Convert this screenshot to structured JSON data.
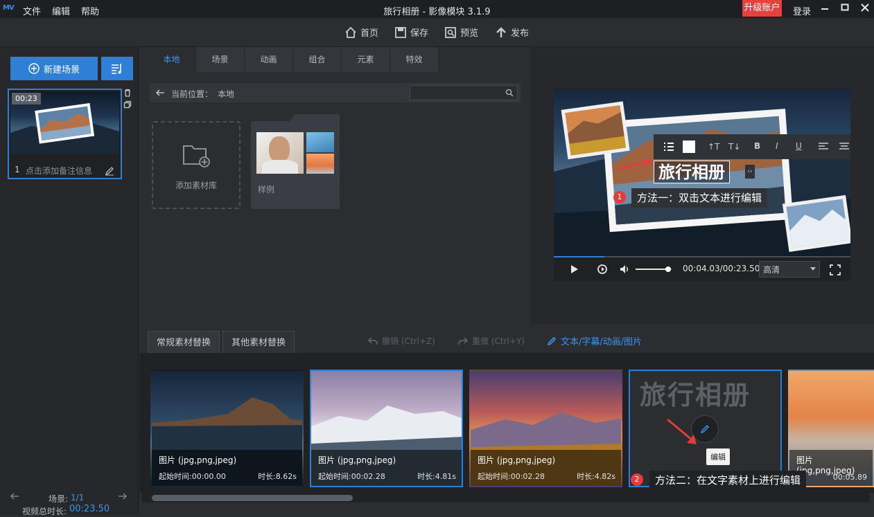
{
  "titlebar": {
    "logo": "MV",
    "menus": [
      "文件",
      "编辑",
      "帮助"
    ],
    "title": "旅行相册 - 影像模块 3.1.9",
    "upgrade": "升级账户",
    "login": "登录"
  },
  "toolbar": {
    "home": "首页",
    "save": "保存",
    "preview": "预览",
    "publish": "发布"
  },
  "left": {
    "new_scene": "新建场景",
    "scene_duration": "00:23",
    "scene_index": "1",
    "scene_note": "点击添加备注信息",
    "scene_label": "场景:",
    "scene_count": "1/1",
    "total_label": "视频总时长:",
    "total_time": "00:23.50"
  },
  "library": {
    "tabs": [
      "本地",
      "场景",
      "动画",
      "组合",
      "元素",
      "特效"
    ],
    "path_label": "当前位置：",
    "path_value": "本地",
    "add_library": "添加素材库",
    "sample": "样例"
  },
  "preview": {
    "title_text": "旅行相册",
    "hint1_num": "1",
    "hint1": "方法一：双击文本进行编辑",
    "time": "00:04.03/00:23.50",
    "quality": "高清",
    "progress": 0.17,
    "volume": 0.9
  },
  "bottom": {
    "tab1": "常规素材替换",
    "tab2": "其他素材替换",
    "undo": "撤销 (Ctrl+Z)",
    "redo": "重做 (Ctrl+Y)",
    "edit_link": "文本/字幕/动画/图片",
    "clips": [
      {
        "type": "图片 (jpg,png,jpeg)",
        "start": "起始时间:00:00.00",
        "dur": "时长:8.62s"
      },
      {
        "type": "图片 (jpg,png,jpeg)",
        "start": "起始时间:00:02.28",
        "dur": "时长:4.81s"
      },
      {
        "type": "图片 (jpg,png,jpeg)",
        "start": "起始时间:00:02.28",
        "dur": "时长:4.82s"
      },
      {
        "title": "旅行相册",
        "edit": "编辑"
      },
      {
        "type": "图片 (jpg,png,jpeg)",
        "start": "00:05.89"
      }
    ],
    "hint2_num": "2",
    "hint2": "方法二：在文字素材上进行编辑"
  },
  "colors": {
    "accent": "#2f7fd6",
    "danger": "#e23c3c"
  }
}
